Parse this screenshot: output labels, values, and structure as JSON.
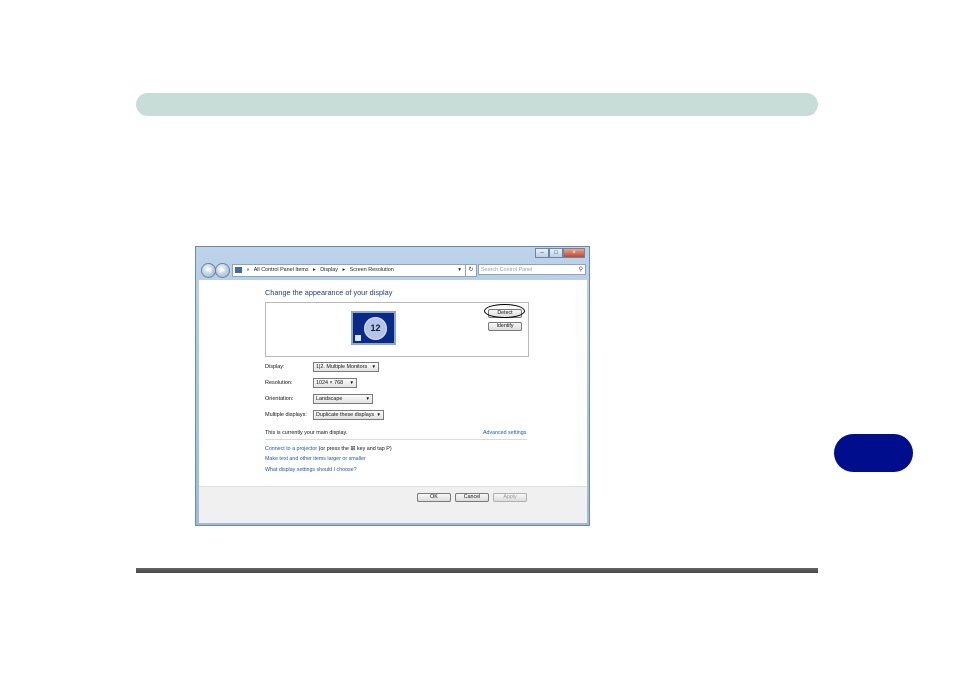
{
  "window": {
    "caption_buttons": {
      "minimize": "–",
      "maximize": "□",
      "close": "×"
    },
    "nav": {
      "back_icon": "◀",
      "forward_icon": "▶"
    },
    "address": {
      "prefix": "«",
      "crumbs": [
        "All Control Panel Items",
        "Display",
        "Screen Resolution"
      ],
      "separator": "▸",
      "dropdown_icon": "▾"
    },
    "refresh_icon": "↻",
    "search": {
      "placeholder": "Search Control Panel",
      "icon": "⚲"
    },
    "title": "Change the appearance of your display",
    "monitor_label": "12",
    "buttons": {
      "detect": "Detect",
      "identify": "Identify"
    },
    "settings": {
      "display": {
        "label": "Display:",
        "value": "1|2. Multiple Monitors"
      },
      "resolution": {
        "label": "Resolution:",
        "value": "1024 × 768"
      },
      "orientation": {
        "label": "Orientation:",
        "value": "Landscape"
      },
      "multiple_displays": {
        "label": "Multiple displays:",
        "value": "Duplicate these displays"
      }
    },
    "main_display_text": "This is currently your main display.",
    "advanced_link": "Advanced settings",
    "projector_link": "Connect to a projector",
    "projector_suffix_a": "(or press the",
    "projector_suffix_b": "key and tap P)",
    "windows_key_icon": "⊞",
    "text_size_link": "Make text and other items larger or smaller",
    "help_link": "What display settings should I choose?",
    "footer": {
      "ok": "OK",
      "cancel": "Cancel",
      "apply": "Apply"
    }
  },
  "colors": {
    "top_bar": "#c8ddd8",
    "chapter_tab": "#000d8c",
    "link": "#1c55c1",
    "title": "#1e3c8a"
  }
}
